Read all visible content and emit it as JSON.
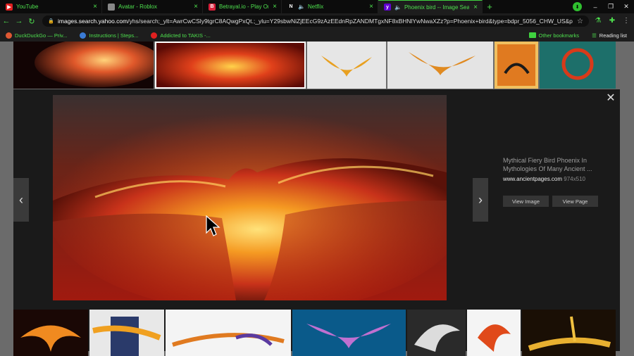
{
  "tabs": [
    {
      "title": "YouTube",
      "fav_color": "#e02020",
      "fav_glyph": "▶",
      "active": false,
      "width": 145,
      "audio": false
    },
    {
      "title": "Avatar - Roblox",
      "fav_color": "#888888",
      "fav_glyph": "",
      "active": false,
      "width": 143,
      "audio": false
    },
    {
      "title": "Betrayal.io - Play Online!",
      "fav_color": "#d9213c",
      "fav_glyph": "B",
      "active": false,
      "width": 112,
      "audio": false
    },
    {
      "title": "Netflix",
      "fav_color": "#0c0c0c",
      "fav_glyph": "N",
      "active": false,
      "width": 137,
      "audio": true
    },
    {
      "title": "Phoenix bird -- Image Search Re",
      "fav_color": "#6001d2",
      "fav_glyph": "y",
      "active": true,
      "width": 148,
      "audio": true
    }
  ],
  "new_tab": "+",
  "window_controls": [
    "–",
    "❐",
    "✕"
  ],
  "address": {
    "domain": "images.search.yahoo.com",
    "path": "/yhs/search;_ylt=AwrCwCSly9tgrC8AQwgPxQt.;_ylu=Y29sbwNiZjEEcG9zAzEEdnRpZANDMTgxNF8xBHNlYwNwaXZz?p=Phoenix+bird&type=bdpr_5056_CHW_US&param..."
  },
  "bookmarks": [
    {
      "label": "DuckDuckGo — Priv...",
      "color": "#de5833"
    },
    {
      "label": "Instructions | Steps...",
      "color": "#3a7bd5"
    },
    {
      "label": "Addicted to TAKIS -...",
      "color": "#e02020"
    }
  ],
  "bookmarks_right": {
    "other": "Other bookmarks",
    "reading": "Reading list"
  },
  "viewer": {
    "title": "Mythical Fiery Bird Phoenix In Mythologies Of Many Ancient ...",
    "source": "www.ancientpages.com",
    "dimensions": "974x510",
    "view_image": "View Image",
    "view_page": "View Page",
    "prev": "‹",
    "next": "›",
    "close": "✕"
  },
  "colors": {
    "accent": "#4ee04e",
    "yahoo": "#6001d2"
  }
}
